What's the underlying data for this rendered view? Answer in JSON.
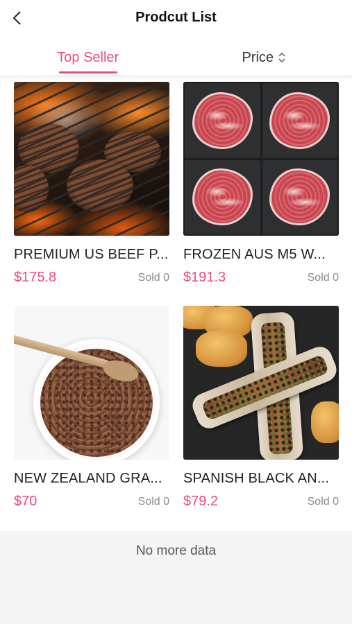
{
  "header": {
    "title": "Prodcut List",
    "back_icon": "back-arrow-icon"
  },
  "tabs": [
    {
      "label": "Top Seller",
      "active": true
    },
    {
      "label": "Price",
      "active": false,
      "icon": "sort-arrows-icon"
    }
  ],
  "accent_color": "#e94d7f",
  "products": [
    {
      "name": "PREMIUM US BEEF P...",
      "price": "$175.8",
      "sold": "Sold 0",
      "image": "grilled-burger-patties"
    },
    {
      "name": "FROZEN AUS M5 W...",
      "price": "$191.3",
      "sold": "Sold 0",
      "image": "raw-ribeye-steaks"
    },
    {
      "name": "NEW ZEALAND GRA...",
      "price": "$70",
      "sold": "Sold 0",
      "image": "ground-beef-bowl"
    },
    {
      "name": "SPANISH BLACK AN...",
      "price": "$79.2",
      "sold": "Sold 0",
      "image": "roasted-bone-marrow"
    }
  ],
  "footer": {
    "message": "No more data"
  }
}
